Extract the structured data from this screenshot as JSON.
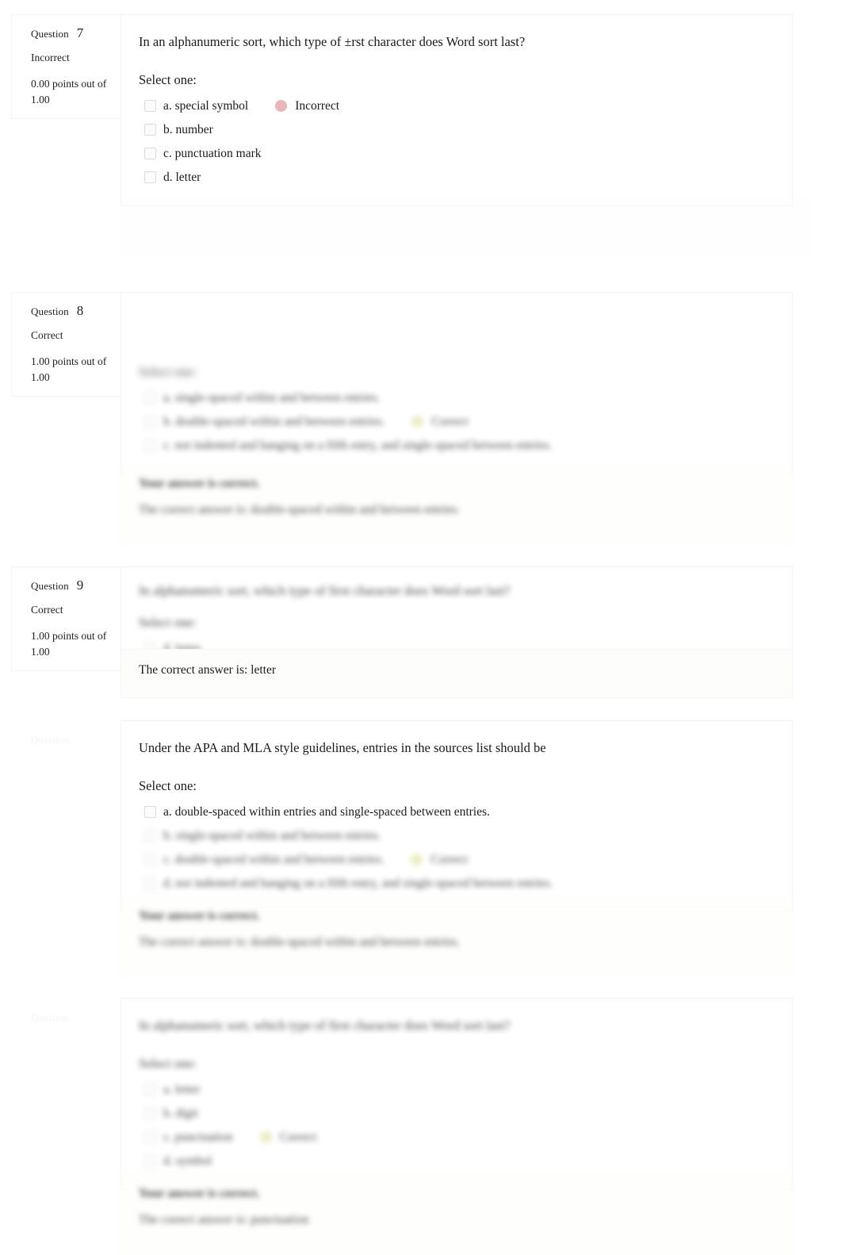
{
  "page": {
    "kind": "quiz-review",
    "colors": {
      "incorrect_marker": "#e8b7bb",
      "correct_marker": "#e6e9b4",
      "text": "#1a1a1a",
      "panel_bg": "#ffffff",
      "feedback_bg": "#fefefc"
    }
  },
  "labels": {
    "question_word": "Question",
    "select_one": "Select one:"
  },
  "questions": [
    {
      "id": "q7",
      "number": "7",
      "state": "Incorrect",
      "grade": "0.00 points out of 1.00",
      "grade_line1": "0.00 points out of",
      "grade_line2": "1.00",
      "text": "In an alphanumeric sort, which type of ±rst character does Word sort last?",
      "select_one": "Select one:",
      "answers": [
        {
          "label": "a. special symbol",
          "feedback": "Incorrect",
          "marker": "incorrect"
        },
        {
          "label": "b. number",
          "feedback": "",
          "marker": "none"
        },
        {
          "label": "c. punctuation mark",
          "feedback": "",
          "marker": "none"
        },
        {
          "label": "d. letter",
          "feedback": "",
          "marker": "none"
        }
      ],
      "feedback": []
    },
    {
      "id": "q8",
      "number": "8",
      "state": "Correct",
      "grade": "1.00 points out of 1.00",
      "grade_line1": "1.00 points out of",
      "grade_line2": "1.00",
      "text": "",
      "select_one": "Select one:",
      "answers": [
        {
          "label": "a. single-spaced within and between entries.",
          "feedback": "",
          "marker": "none"
        },
        {
          "label": "b. double-spaced within and between entries.",
          "feedback": "Correct",
          "marker": "correct"
        },
        {
          "label": "c. not indented and hanging on a fifth entry, and single-spaced between entries.",
          "feedback": "",
          "marker": "none"
        }
      ],
      "feedback": [
        {
          "text": "Your answer is correct.",
          "strong": true
        },
        {
          "text": "The correct answer is: double-spaced within and between entries.",
          "strong": false
        }
      ]
    },
    {
      "id": "q9",
      "number": "9",
      "state": "Correct",
      "grade": "1.00 points out of 1.00",
      "grade_line1": "1.00 points out of",
      "grade_line2": "1.00",
      "text": "In alphanumeric sort, which type of first character does Word sort last?",
      "select_one": "Select one:",
      "answers": [
        {
          "label": "d. letter",
          "feedback": "",
          "marker": "none"
        }
      ],
      "feedback": [
        {
          "text": "The correct answer is: letter",
          "strong": false
        }
      ]
    },
    {
      "id": "q10",
      "number": "",
      "state": "",
      "grade": "",
      "grade_line1": "",
      "grade_line2": "",
      "text": "Under the APA and MLA style guidelines, entries in the sources list should be",
      "select_one": "Select one:",
      "answers": [
        {
          "label": "a. double-spaced within entries and single-spaced between entries.",
          "feedback": "",
          "marker": "none"
        },
        {
          "label": "b. single-spaced within and between entries.",
          "feedback": "",
          "marker": "none"
        },
        {
          "label": "c. double-spaced within and between entries.",
          "feedback": "Correct",
          "marker": "correct"
        },
        {
          "label": "d. not indented and hanging on a fifth entry, and single-spaced between entries.",
          "feedback": "",
          "marker": "none"
        }
      ],
      "feedback": [
        {
          "text": "Your answer is correct.",
          "strong": true
        },
        {
          "text": "The correct answer is: double-spaced within and between entries.",
          "strong": false
        }
      ]
    },
    {
      "id": "q11",
      "number": "",
      "state": "",
      "grade": "",
      "grade_line1": "",
      "grade_line2": "",
      "text": "In alphanumeric sort, which type of first character does Word sort last?",
      "select_one": "Select one:",
      "answers": [
        {
          "label": "a. letter",
          "feedback": "",
          "marker": "none"
        },
        {
          "label": "b. digit",
          "feedback": "",
          "marker": "none"
        },
        {
          "label": "c. punctuation",
          "feedback": "Correct",
          "marker": "correct"
        },
        {
          "label": "d. symbol",
          "feedback": "",
          "marker": "none"
        }
      ],
      "feedback": [
        {
          "text": "Your answer is correct.",
          "strong": true
        },
        {
          "text": "The correct answer is: punctuation",
          "strong": false
        }
      ]
    }
  ]
}
